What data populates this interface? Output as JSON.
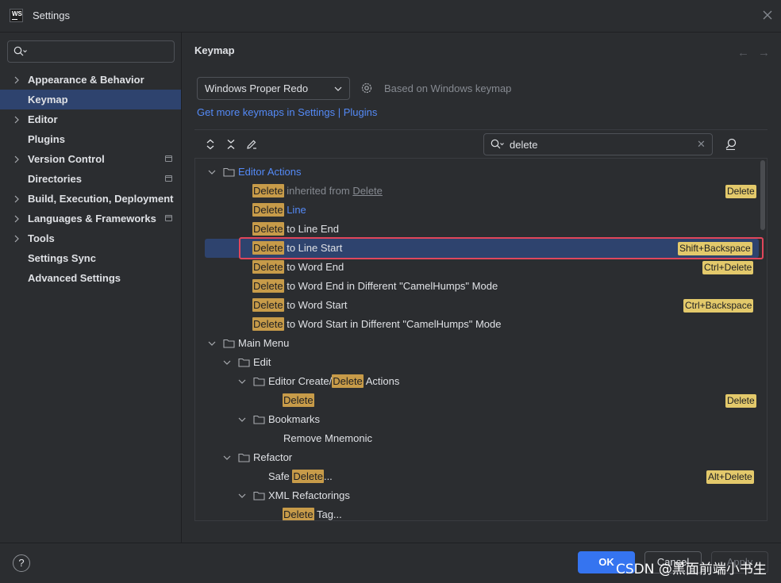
{
  "window": {
    "title": "Settings",
    "logo_text": "WS"
  },
  "sidebar": {
    "search_placeholder": "",
    "items": [
      {
        "label": "Appearance & Behavior",
        "expandable": true,
        "project": false
      },
      {
        "label": "Keymap",
        "expandable": false,
        "project": false,
        "selected": true
      },
      {
        "label": "Editor",
        "expandable": true,
        "project": false
      },
      {
        "label": "Plugins",
        "expandable": false,
        "project": false
      },
      {
        "label": "Version Control",
        "expandable": true,
        "project": true
      },
      {
        "label": "Directories",
        "expandable": false,
        "project": true
      },
      {
        "label": "Build, Execution, Deployment",
        "expandable": true,
        "project": false
      },
      {
        "label": "Languages & Frameworks",
        "expandable": true,
        "project": true
      },
      {
        "label": "Tools",
        "expandable": true,
        "project": false
      },
      {
        "label": "Settings Sync",
        "expandable": false,
        "project": false
      },
      {
        "label": "Advanced Settings",
        "expandable": false,
        "project": false
      }
    ]
  },
  "main": {
    "title": "Keymap",
    "keymap_select": "Windows Proper Redo",
    "based_on": "Based on Windows keymap",
    "more_link": "Get more keymaps in Settings | Plugins",
    "filter_value": "delete",
    "tree": {
      "editor_actions": "Editor Actions",
      "delete_hl": "Delete",
      "inherited_from": "inherited from",
      "inherited_target": "Delete",
      "line": "Line",
      "to_line_end": "to Line End",
      "to_line_start": "to Line Start",
      "to_word_end": "to Word End",
      "to_word_end_camel": "to Word End in Different \"CamelHumps\" Mode",
      "to_word_start": "to Word Start",
      "to_word_start_camel": "to Word Start in Different \"CamelHumps\" Mode",
      "main_menu": "Main Menu",
      "edit": "Edit",
      "editor_create_prefix": "Editor Create/",
      "editor_create_suffix": "Actions",
      "bookmarks": "Bookmarks",
      "remove_mnemonic": "Remove Mnemonic",
      "refactor": "Refactor",
      "safe": "Safe",
      "safe_suffix": "...",
      "xml_refactorings": "XML Refactorings",
      "tag_suffix": "Tag..."
    },
    "shortcuts": {
      "delete": "Delete",
      "shift_backspace": "Shift+Backspace",
      "ctrl_delete": "Ctrl+Delete",
      "ctrl_backspace": "Ctrl+Backspace",
      "edit_delete": "Delete",
      "alt_delete": "Alt+Delete"
    }
  },
  "footer": {
    "help": "?",
    "ok": "OK",
    "cancel": "Cancel",
    "apply": "Apply",
    "watermark": "CSDN @黑面前端小书生"
  },
  "colors": {
    "accent": "#3574f0",
    "selection": "#2e436e",
    "match_highlight": "#c79b49",
    "shortcut_badge": "#e3c96b",
    "focus_outline": "#e0465b",
    "link": "#548af7"
  }
}
